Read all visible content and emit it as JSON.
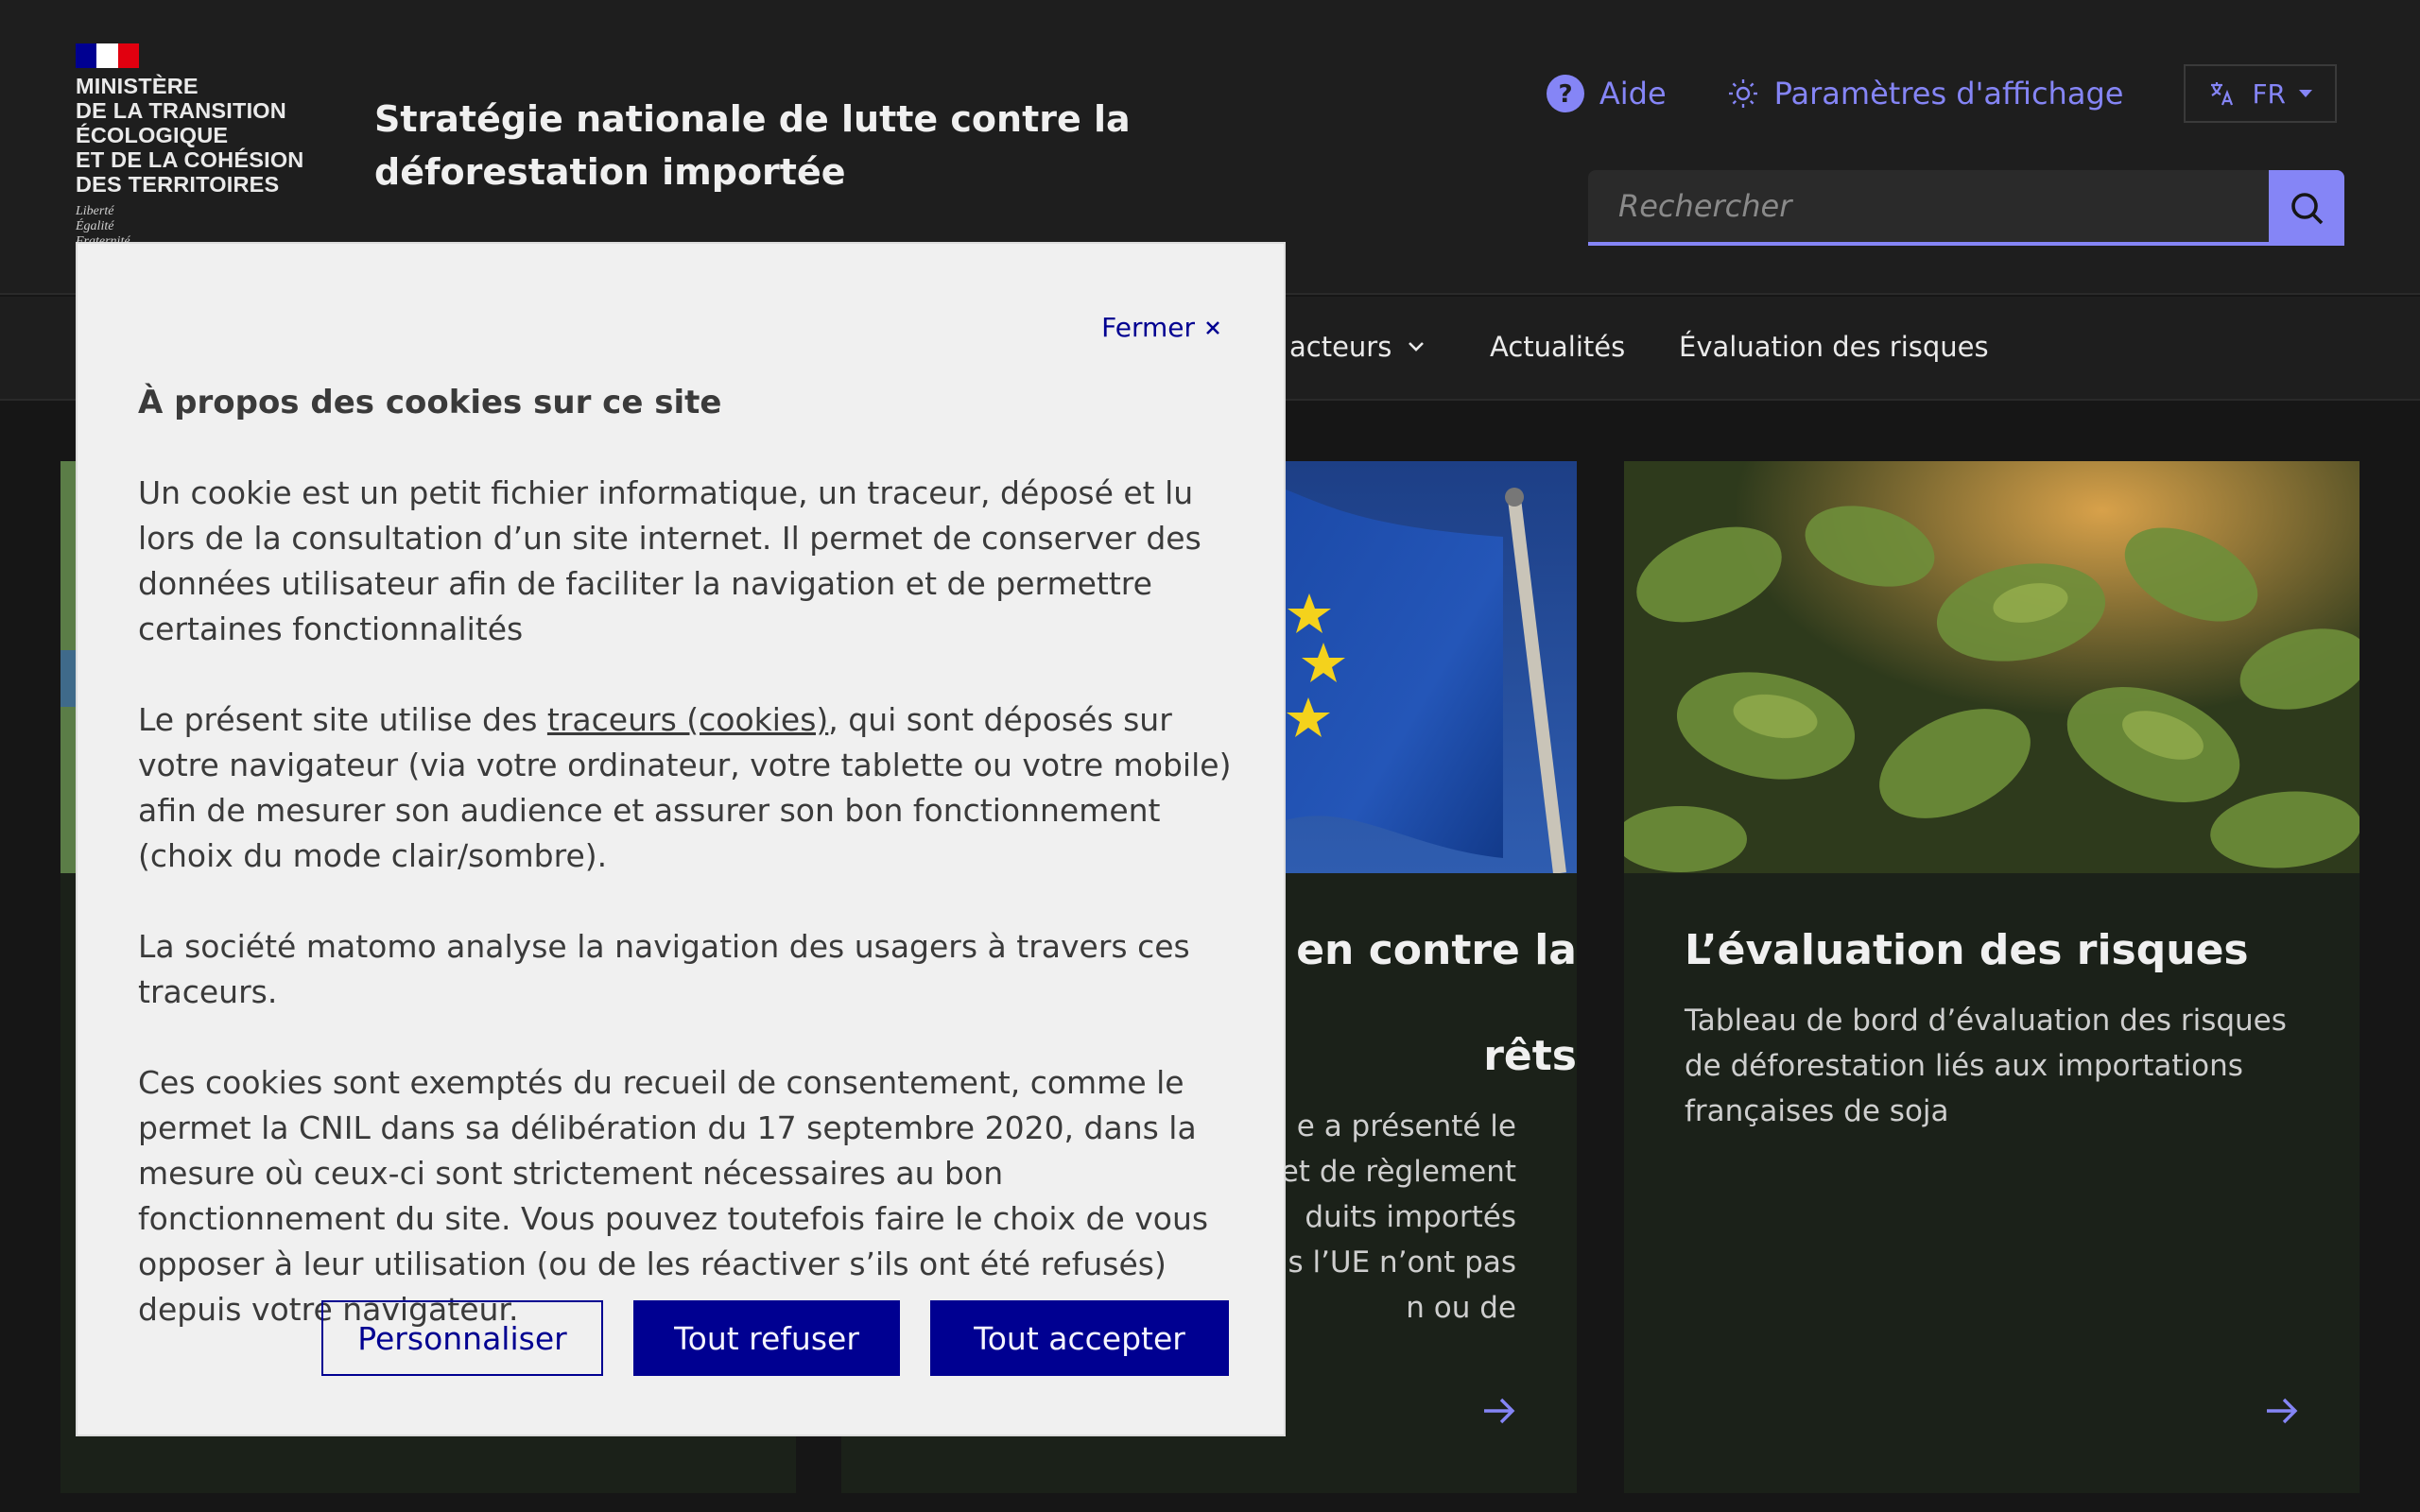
{
  "header": {
    "ministry_lines": [
      "Ministère",
      "de la transition",
      "écologique",
      "et de la cohésion",
      "des territoires"
    ],
    "motto_lines": [
      "Liberté",
      "Égalité",
      "Fraternité"
    ],
    "site_title": "Stratégie nationale de lutte contre la déforestation importée",
    "help_label": "Aide",
    "display_label": "Paramètres d'affichage",
    "lang_label": "FR",
    "search_placeholder": "Rechercher"
  },
  "nav": {
    "items": [
      {
        "label": "acteurs",
        "has_dropdown": true
      },
      {
        "label": "Actualités",
        "has_dropdown": false
      },
      {
        "label": "Évaluation des risques",
        "has_dropdown": false
      }
    ]
  },
  "cards": [
    {
      "title": "",
      "desc": ""
    },
    {
      "title": "en contre la\n\nrêts",
      "desc": "e a présenté le\net de règlement\nduits importés\nuis l’UE n’ont pas\nn ou de"
    },
    {
      "title": "L’évaluation des risques",
      "desc": "Tableau de bord d’évaluation des risques de déforestation liés aux importations françaises de soja"
    }
  ],
  "modal": {
    "close_label": "Fermer",
    "title": "À propos des cookies sur ce site",
    "p1": "Un cookie est un petit fichier informatique, un traceur, déposé et lu lors de la consultation d’un site internet. Il permet de conserver des données utilisateur afin de faciliter la navigation et de permettre certaines fonctionnalités",
    "p2_before": "Le présent site utilise des ",
    "p2_link": "traceurs (cookies)",
    "p2_after": ", qui sont déposés sur votre navigateur (via votre ordinateur, votre tablette ou votre mobile) afin de mesurer son audience et assurer son bon fonctionnement (choix du mode clair/sombre).",
    "p3": "La société matomo analyse la navigation des usagers à travers ces traceurs.",
    "p4": "Ces cookies sont exemptés du recueil de consentement, comme le permet la CNIL dans sa délibération du 17 septembre 2020, dans la mesure où ceux-ci sont strictement nécessaires au bon fonctionnement du site. Vous pouvez toutefois faire le choix de vous opposer à leur utilisation (ou de les réactiver s’ils ont été refusés) depuis votre navigateur.",
    "btn_customize": "Personnaliser",
    "btn_refuse": "Tout refuser",
    "btn_accept": "Tout accepter"
  },
  "colors": {
    "accent": "#8585f6",
    "primary_button": "#000091",
    "flag_blue": "#000091",
    "flag_red": "#e1000f"
  }
}
